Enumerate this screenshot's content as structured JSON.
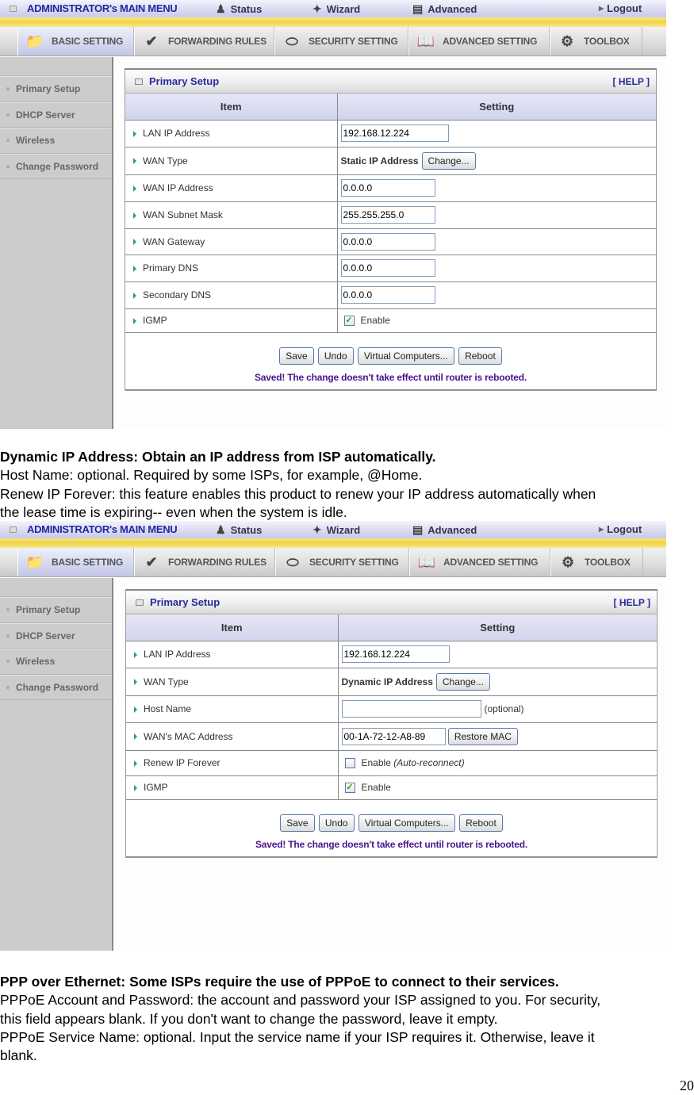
{
  "topmenu": {
    "admin": "ADMINISTRATOR's MAIN MENU",
    "status": "Status",
    "wizard": "Wizard",
    "advanced": "Advanced",
    "logout": "Logout"
  },
  "tabs": [
    {
      "label": "BASIC SETTING",
      "icon": "folder-icon"
    },
    {
      "label": "FORWARDING RULES",
      "icon": "forwarding-icon"
    },
    {
      "label": "SECURITY SETTING",
      "icon": "security-icon"
    },
    {
      "label": "ADVANCED SETTING",
      "icon": "advanced-icon"
    },
    {
      "label": "TOOLBOX",
      "icon": "toolbox-icon"
    }
  ],
  "sidebar": {
    "items": [
      {
        "label": "Primary Setup"
      },
      {
        "label": "DHCP Server"
      },
      {
        "label": "Wireless"
      },
      {
        "label": "Change Password"
      }
    ]
  },
  "panel": {
    "title": "Primary Setup",
    "help": "[ HELP ]",
    "col_item": "Item",
    "col_setting": "Setting",
    "buttons": {
      "save": "Save",
      "undo": "Undo",
      "virtual": "Virtual Computers...",
      "reboot": "Reboot",
      "change": "Change...",
      "restore_mac": "Restore MAC"
    },
    "saved_msg": "Saved! The change doesn't take effect until router is rebooted."
  },
  "screen1": {
    "rows": [
      {
        "label": "LAN IP Address",
        "value": "192.168.12.224"
      },
      {
        "label": "WAN Type",
        "value": "Static IP Address"
      },
      {
        "label": "WAN IP Address",
        "value": "0.0.0.0"
      },
      {
        "label": "WAN Subnet Mask",
        "value": "255.255.255.0"
      },
      {
        "label": "WAN Gateway",
        "value": "0.0.0.0"
      },
      {
        "label": "Primary DNS",
        "value": "0.0.0.0"
      },
      {
        "label": "Secondary DNS",
        "value": "0.0.0.0"
      },
      {
        "label": "IGMP",
        "value": "Enable",
        "checked": true
      }
    ]
  },
  "screen2": {
    "rows": [
      {
        "label": "LAN IP Address",
        "value": "192.168.12.224"
      },
      {
        "label": "WAN Type",
        "value": "Dynamic IP Address"
      },
      {
        "label": "Host Name",
        "value": "",
        "hint": "(optional)"
      },
      {
        "label": "WAN's MAC Address",
        "value": "00-1A-72-12-A8-89"
      },
      {
        "label": "Renew IP Forever",
        "value": "Enable",
        "hint": "(Auto-reconnect)",
        "checked": false
      },
      {
        "label": "IGMP",
        "value": "Enable",
        "checked": true
      }
    ]
  },
  "doc": {
    "dynamic_heading": "Dynamic IP Address: Obtain an IP address from ISP automatically.",
    "host_name": "Host Name: optional. Required by some ISPs, for example, @Home.",
    "renew_1": "Renew IP Forever: this feature enables this product to renew your IP address automatically when",
    "renew_2": "the lease time is expiring-- even when the system is idle.",
    "pppoe_heading": "PPP over Ethernet: Some ISPs require the use of PPPoE to connect to their services.",
    "pppoe_account_1": "PPPoE Account and Password: the account and password your ISP assigned to you. For security,",
    "pppoe_account_2": "this field appears blank. If you don't want to change the password, leave it empty.",
    "pppoe_service_1": "PPPoE Service Name: optional. Input the service name if your ISP requires it. Otherwise, leave it",
    "pppoe_service_2": "blank.",
    "page_number": "20"
  }
}
